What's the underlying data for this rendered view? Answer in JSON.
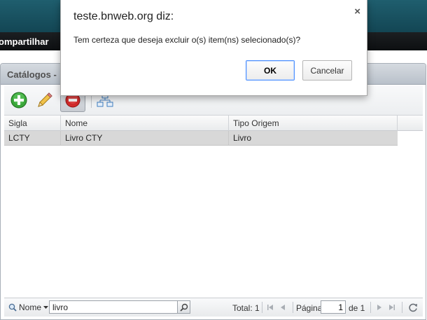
{
  "app": {
    "nav_item": "ompartilhar"
  },
  "panel": {
    "title": "Catálogos -"
  },
  "toolbar": {
    "icons": [
      "add-icon",
      "edit-pencil-icon",
      "delete-icon",
      "hierarchy-icon"
    ],
    "active": "delete-icon"
  },
  "grid": {
    "columns": [
      "Sigla",
      "Nome",
      "Tipo Origem"
    ],
    "rows": [
      {
        "sigla": "LCTY",
        "nome": "Livro CTY",
        "tipo_origem": "Livro",
        "selected": true
      }
    ]
  },
  "footer": {
    "search_field": "Nome",
    "search_value": "livro",
    "total_label": "Total: 1",
    "page_label": "Página",
    "page_value": "1",
    "page_of": "de 1"
  },
  "dialog": {
    "title": "teste.bnweb.org diz:",
    "close": "×",
    "message": "Tem certeza que deseja excluir o(s) item(ns) selecionado(s)?",
    "ok_label": "OK",
    "cancel_label": "Cancelar"
  },
  "colors": {
    "header": "#1f5e6e",
    "nav": "#0d0f11",
    "selected_row": "#d8d8d8",
    "dialog_focus": "#4d90fe"
  }
}
